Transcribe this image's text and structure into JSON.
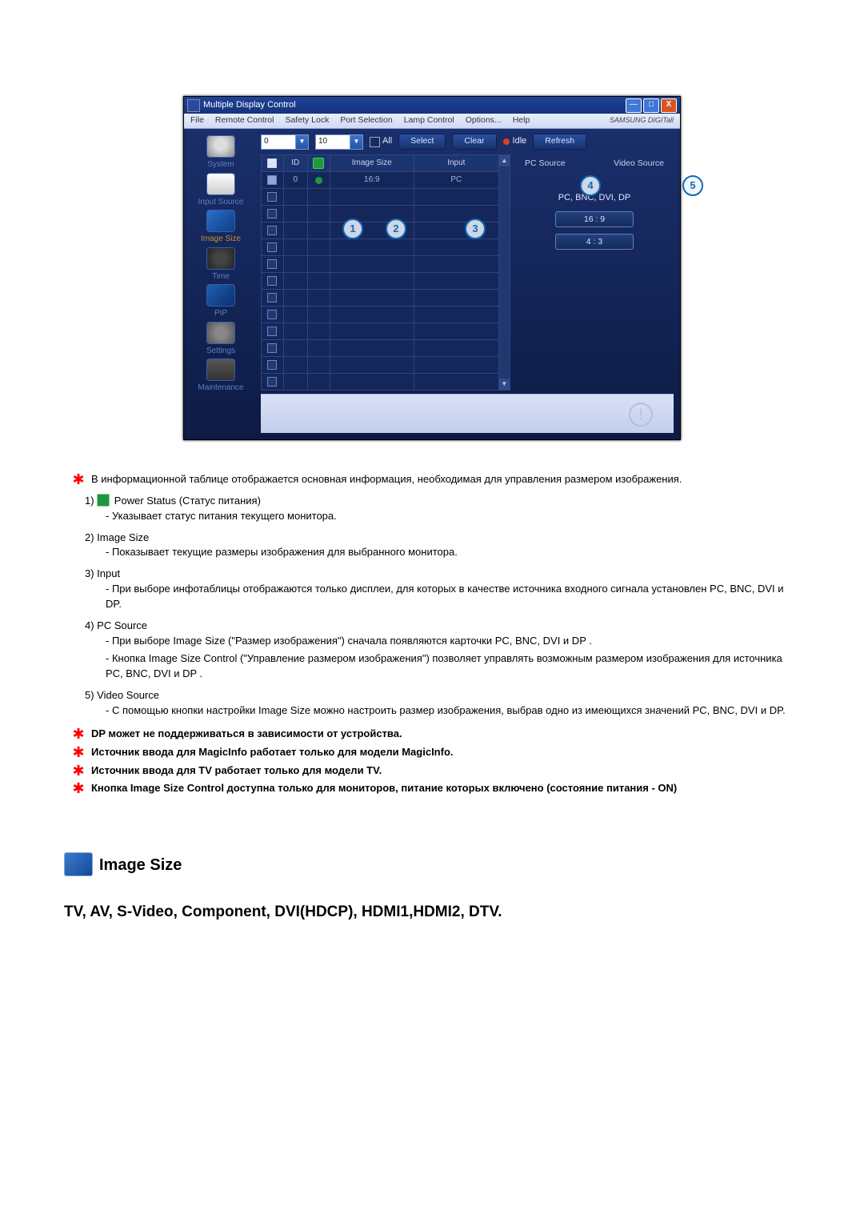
{
  "window": {
    "title": "Multiple Display Control",
    "brand": "SAMSUNG DIGITall"
  },
  "menubar": [
    "File",
    "Remote Control",
    "Safety Lock",
    "Port Selection",
    "Lamp Control",
    "Options...",
    "Help"
  ],
  "sidebar": [
    {
      "label": "System"
    },
    {
      "label": "Input Source"
    },
    {
      "label": "Image Size"
    },
    {
      "label": "Time"
    },
    {
      "label": "PIP"
    },
    {
      "label": "Settings"
    },
    {
      "label": "Maintenance"
    }
  ],
  "toolbar": {
    "combo1": "0",
    "combo2": "10",
    "all": "All",
    "select": "Select",
    "clear": "Clear",
    "idle": "Idle",
    "refresh": "Refresh"
  },
  "grid": {
    "headers": {
      "id": "ID",
      "imgsize": "Image Size",
      "input": "Input"
    },
    "row": {
      "id": "0",
      "imgsize": "16:9",
      "input": "PC"
    }
  },
  "right": {
    "pc": "PC Source",
    "video": "Video Source",
    "title": "PC, BNC, DVI, DP",
    "btn1": "16 : 9",
    "btn2": "4 : 3"
  },
  "callouts": {
    "c1": "1",
    "c2": "2",
    "c3": "3",
    "c4": "4",
    "c5": "5"
  },
  "desc": {
    "intro": "В информационной таблице отображается основная информация, необходимая для управления размером изображения.",
    "item1_t": "1)  ",
    "item1_a": "Power Status (Статус питания)",
    "item1_b": "- Указывает статус питания текущего монитора.",
    "item2_t": "2)  Image Size",
    "item2_b": "- Показывает текущие размеры изображения для выбранного монитора.",
    "item3_t": "3)  Input",
    "item3_b": "- При выборе инфотаблицы отображаются только дисплеи, для которых в качестве источника входного сигнала установлен PC, BNC, DVI и DP.",
    "item4_t": "4)  PC Source",
    "item4_b": "- При выборе Image Size (\"Размер изображения\") сначала появляются карточки PC, BNC, DVI и DP .",
    "item4_c": "- Кнопка Image Size Control (\"Управление размером изображения\") позволяет управлять возможным размером изображения для источника PC, BNC, DVI и DP .",
    "item5_t": "5)  Video Source",
    "item5_b": "- С помощью кнопки настройки Image Size можно настроить размер изображения, выбрав одно из имеющихся значений PC, BNC, DVI и DP.",
    "n1": "DP может не поддерживаться в зависимости от устройства.",
    "n2": "Источник ввода для MagicInfo работает только для модели MagicInfo.",
    "n3": "Источник ввода для TV работает только для модели TV.",
    "n4": "Кнопка Image Size Control доступна только для мониторов, питание которых включено (состояние питания - ON)"
  },
  "sec": {
    "title": "Image Size",
    "sub": "TV, AV, S-Video, Component, DVI(HDCP), HDMI1,HDMI2, DTV."
  }
}
